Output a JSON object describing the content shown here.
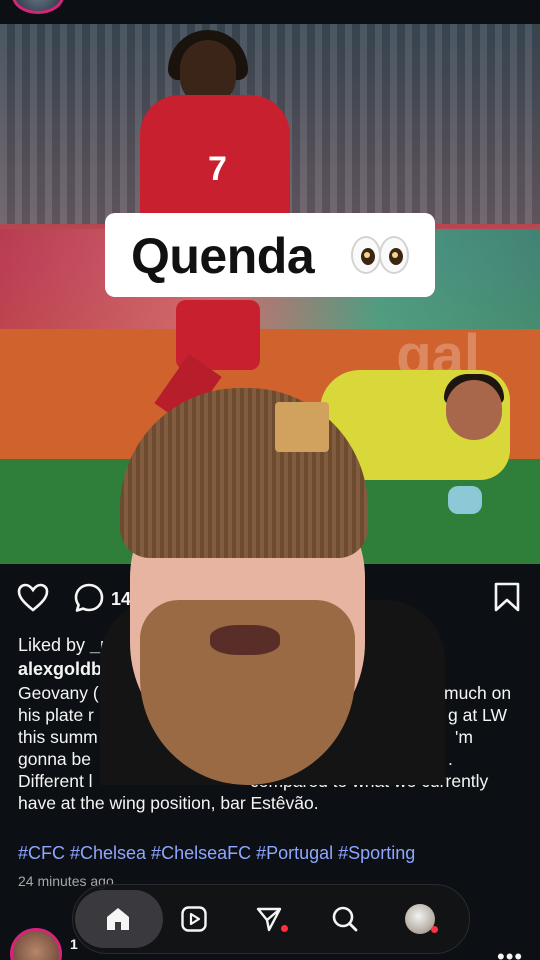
{
  "post": {
    "image_caption": "Quenda",
    "caption_emoji": "eyes-emoji",
    "comment_count": "14",
    "liked_by_prefix": "Liked by ",
    "liked_by_user": "_pe",
    "username": "alexgoldb",
    "caption_lines_left": [
      "Geovany (",
      "his plate r",
      "this summ",
      "gonna be",
      "Different l"
    ],
    "caption_lines_right": [
      "much on",
      "g at LW",
      "'m",
      "."
    ],
    "caption_line5_tail": "compared to what we currently",
    "caption_line6": "have at the wing position, bar Estêvão.",
    "hashtags": "#CFC #Chelsea #ChelseaFC #Portugal #Sporting",
    "timestamp": "24 minutes ago"
  },
  "icons": {
    "like": "heart-icon",
    "comment": "comment-icon",
    "save": "bookmark-icon",
    "home": "home-icon",
    "reels": "reels-icon",
    "send": "send-icon",
    "search": "search-icon",
    "profile": "profile-avatar",
    "more": "more-icon"
  },
  "next_post": {
    "username_fragment": "1",
    "more_label": "•••"
  },
  "colors": {
    "background": "#0c1014",
    "hashtag": "#8ea6ff",
    "notification": "#ff3040",
    "story_ring": "#d6247a"
  }
}
